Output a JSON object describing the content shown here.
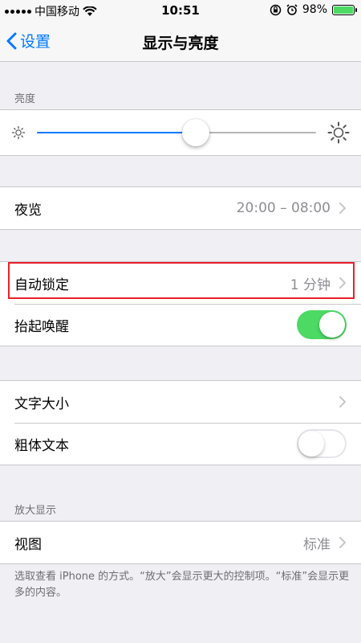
{
  "status_bar": {
    "carrier": "中国移动",
    "time": "10:51",
    "battery": "98%",
    "battery_level": 0.98
  },
  "nav": {
    "back_label": "设置",
    "title": "显示与亮度"
  },
  "brightness": {
    "header": "亮度",
    "level": 0.57
  },
  "night_shift": {
    "label": "夜览",
    "value": "20:00 – 08:00"
  },
  "auto_lock": {
    "label": "自动锁定",
    "value": "1 分钟"
  },
  "raise_to_wake": {
    "label": "抬起唤醒",
    "on": true
  },
  "text_size": {
    "label": "文字大小"
  },
  "bold_text": {
    "label": "粗体文本",
    "on": false
  },
  "zoom": {
    "header": "放大显示",
    "view_label": "视图",
    "view_value": "标准",
    "footnote": "选取查看 iPhone 的方式。“放大”会显示更大的控制项。“标准”会显示更多的内容。"
  },
  "colors": {
    "accent": "#007aff",
    "toggle_on": "#4cd964",
    "highlight": "#e8202a"
  }
}
